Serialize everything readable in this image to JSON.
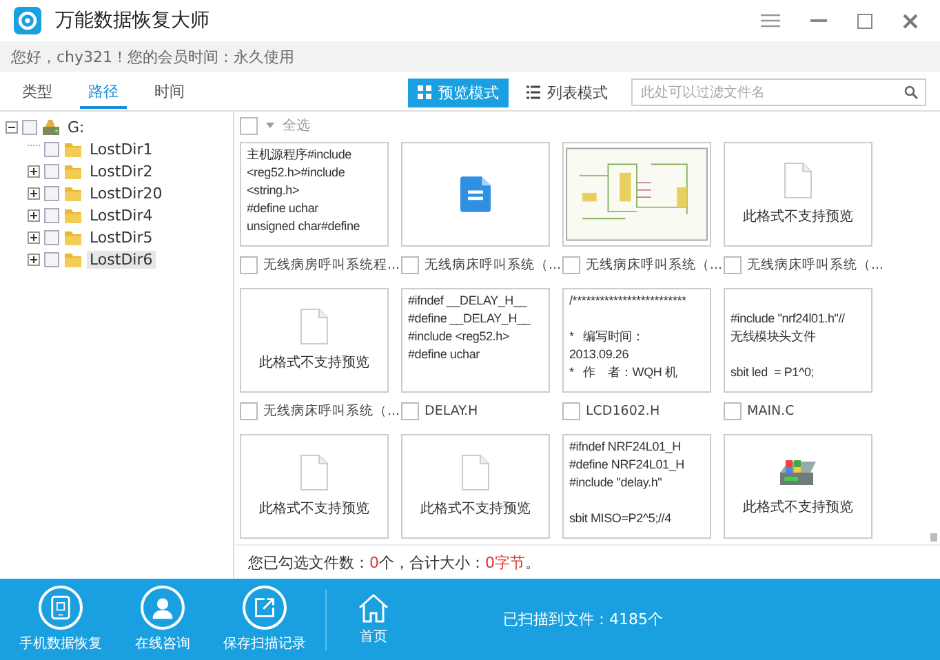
{
  "window": {
    "title": "万能数据恢复大师"
  },
  "greeting": "您好，chy321！您的会员时间：永久使用",
  "tabs": [
    {
      "label": "类型",
      "selected": false
    },
    {
      "label": "路径",
      "selected": true
    },
    {
      "label": "时间",
      "selected": false
    }
  ],
  "view_modes": [
    {
      "label": "预览模式",
      "kind": "grid",
      "selected": true
    },
    {
      "label": "列表模式",
      "kind": "list",
      "selected": false
    }
  ],
  "search": {
    "placeholder": "此处可以过滤文件名"
  },
  "tree": {
    "label": "G:",
    "checked": false,
    "expanded": true,
    "children": [
      {
        "label": "LostDir1",
        "checked": false,
        "expandable": false,
        "selected": false
      },
      {
        "label": "LostDir2",
        "checked": false,
        "expandable": true,
        "selected": false
      },
      {
        "label": "LostDir20",
        "checked": false,
        "expandable": true,
        "selected": false
      },
      {
        "label": "LostDir4",
        "checked": false,
        "expandable": true,
        "selected": false
      },
      {
        "label": "LostDir5",
        "checked": false,
        "expandable": true,
        "selected": false
      },
      {
        "label": "LostDir6",
        "checked": false,
        "expandable": true,
        "selected": true
      }
    ]
  },
  "select_all": {
    "label": "全选",
    "checked": false
  },
  "cards": [
    {
      "kind": "text",
      "text": "主机源程序#include\n<reg52.h>#include\n<string.h>\n#define uchar\nunsigned char#define",
      "label": "无线病房呼叫系统程...",
      "checked": false
    },
    {
      "kind": "doc",
      "label": "无线病床呼叫系统（...",
      "checked": false
    },
    {
      "kind": "image",
      "label": "无线病床呼叫系统（...",
      "checked": false
    },
    {
      "kind": "unsupported",
      "message": "此格式不支持预览",
      "label": "无线病床呼叫系统（...",
      "checked": false
    },
    {
      "kind": "unsupported",
      "message": "此格式不支持预览",
      "label": "无线病床呼叫系统（...",
      "checked": false
    },
    {
      "kind": "text",
      "text": "#ifndef __DELAY_H__\n#define __DELAY_H__\n#include <reg52.h>\n#define uchar",
      "label": "DELAY.H",
      "checked": false
    },
    {
      "kind": "text",
      "text": "/*************************\n\n*   编写时间：\n2013.09.26\n*   作    者：WQH 机",
      "label": "LCD1602.H",
      "checked": false
    },
    {
      "kind": "text",
      "text": "\n#include \"nrf24l01.h\"//\n无线模块头文件\n\nsbit led  = P1^0;",
      "label": "MAIN.C",
      "checked": false
    },
    {
      "kind": "unsupported",
      "message": "此格式不支持预览"
    },
    {
      "kind": "unsupported",
      "message": "此格式不支持预览"
    },
    {
      "kind": "text",
      "text": "#ifndef NRF24L01_H\n#define NRF24L01_H\n#include \"delay.h\"\n\nsbit MISO=P2^5;//4"
    },
    {
      "kind": "app",
      "message": "此格式不支持预览"
    }
  ],
  "status": {
    "count_label": "您已勾选文件数：",
    "count": "0",
    "count_unit": "个",
    "size_label": "，合计大小：",
    "size": "0字节",
    "end": "。"
  },
  "bottom_buttons": [
    {
      "label": "手机数据恢复",
      "kind": "phone"
    },
    {
      "label": "在线咨询",
      "kind": "person"
    },
    {
      "label": "保存扫描记录",
      "kind": "export"
    }
  ],
  "home": {
    "label": "首页"
  },
  "scan_result": "已扫描到文件：4185个"
}
